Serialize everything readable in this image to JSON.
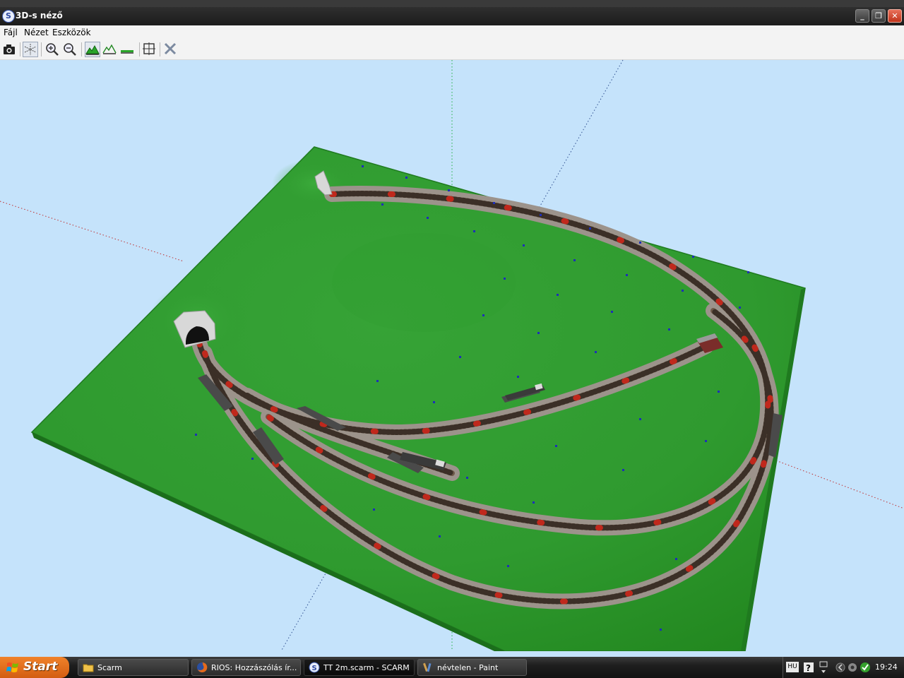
{
  "window": {
    "title": "3D-s néző"
  },
  "menu": [
    "Fájl",
    "Nézet",
    "Eszközök"
  ],
  "toolbar": [
    "camera-icon",
    "axes-toggle-icon",
    "zoom-in-icon",
    "zoom-out-icon",
    "terrain-high-icon",
    "terrain-outline-icon",
    "terrain-flat-icon",
    "fit-view-icon",
    "close-view-icon"
  ],
  "taskbar": {
    "start": "Start",
    "tasks": [
      "Scarm",
      "RIOS: Hozzászólás ír...",
      "TT 2m.scarm - SCARM",
      "névtelen - Paint"
    ],
    "tray": {
      "language": "HU",
      "time": "19:24"
    }
  }
}
